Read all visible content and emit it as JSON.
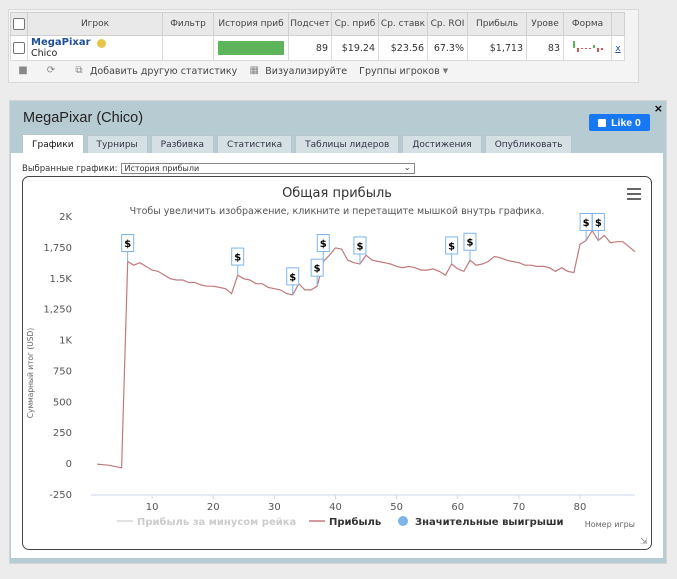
{
  "stats_table": {
    "headers": [
      "Игрок",
      "Фильтр",
      "История приб",
      "Подсчет",
      "Ср. приб",
      "Ср. ставк",
      "Ср. ROI",
      "Прибыль",
      "Урове",
      "Форма"
    ],
    "row": {
      "player": "MegaPixar",
      "site": "Chico",
      "filter": "",
      "count": "89",
      "avg_profit": "$19.24",
      "avg_stake": "$23.56",
      "avg_roi": "67.3%",
      "profit": "$1,713",
      "level": "83",
      "remove": "x"
    }
  },
  "stats_toolbar": {
    "add_stat": "Добавить другую статистику",
    "visualize": "Визуализируйте",
    "player_groups": "Группы игроков"
  },
  "panel": {
    "title": "MegaPixar (Chico)",
    "like_label": "Like 0",
    "close": "×",
    "tabs": [
      "Графики",
      "Турниры",
      "Разбивка",
      "Статистика",
      "Таблицы лидеров",
      "Достижения",
      "Опубликовать"
    ],
    "active_tab": 0,
    "selector_label": "Выбранные графики:",
    "selector_value": "История прибыли"
  },
  "colors": {
    "profit_line": "#c0797d",
    "rake_line": "#d9d9d9",
    "wins_marker": "#7cb5ec",
    "brand": "#1877f2"
  },
  "icons": {
    "trash": "trash-icon",
    "refresh": "refresh-icon",
    "copy": "copy-icon",
    "chart": "chart-icon",
    "menu": "hamburger-menu-icon",
    "flag": "dollar-flag-icon"
  },
  "chart_data": {
    "type": "line",
    "title": "Общая прибыль",
    "subtitle": "Чтобы увеличить изображение, кликните и перетащите мышкой внутрь графика.",
    "xlabel": "Номер игры",
    "ylabel": "Суммарный итог (USD)",
    "xlim": [
      0,
      89
    ],
    "ylim": [
      -250,
      2000
    ],
    "x_ticks": [
      10,
      20,
      30,
      40,
      50,
      60,
      70,
      80
    ],
    "y_ticks": [
      -250,
      0,
      250,
      500,
      750,
      1000,
      1250,
      1500,
      1750,
      2000
    ],
    "y_tick_labels": [
      "-250",
      "0",
      "250",
      "500",
      "750",
      "1K",
      "1,250",
      "1.5K",
      "1,750",
      "2K"
    ],
    "grid": false,
    "legend": [
      {
        "name": "Прибыль за минусом рейка",
        "enabled": false
      },
      {
        "name": "Прибыль",
        "enabled": true
      },
      {
        "name": "Значительные выигрыши",
        "enabled": true
      }
    ],
    "legend_position": "bottom",
    "series": [
      {
        "name": "Прибыль",
        "x": [
          1,
          2,
          3,
          4,
          5,
          6,
          7,
          8,
          9,
          10,
          11,
          12,
          13,
          14,
          15,
          16,
          17,
          18,
          19,
          20,
          21,
          22,
          23,
          24,
          25,
          26,
          27,
          28,
          29,
          30,
          31,
          32,
          33,
          34,
          35,
          36,
          37,
          38,
          39,
          40,
          41,
          42,
          43,
          44,
          45,
          46,
          47,
          48,
          49,
          50,
          51,
          52,
          53,
          54,
          55,
          56,
          57,
          58,
          59,
          60,
          61,
          62,
          63,
          64,
          65,
          66,
          67,
          68,
          69,
          70,
          71,
          72,
          73,
          74,
          75,
          76,
          77,
          78,
          79,
          80,
          81,
          82,
          83,
          84,
          85,
          86,
          87,
          88,
          89
        ],
        "values": [
          0,
          -5,
          -10,
          -20,
          -30,
          1640,
          1610,
          1630,
          1600,
          1570,
          1560,
          1530,
          1500,
          1490,
          1490,
          1470,
          1470,
          1450,
          1440,
          1440,
          1430,
          1420,
          1380,
          1530,
          1500,
          1490,
          1460,
          1460,
          1430,
          1420,
          1410,
          1380,
          1370,
          1460,
          1410,
          1410,
          1440,
          1640,
          1690,
          1750,
          1740,
          1650,
          1630,
          1620,
          1690,
          1650,
          1640,
          1630,
          1620,
          1600,
          1590,
          1600,
          1590,
          1570,
          1570,
          1580,
          1560,
          1530,
          1620,
          1580,
          1560,
          1650,
          1610,
          1620,
          1640,
          1680,
          1670,
          1650,
          1640,
          1630,
          1610,
          1610,
          1600,
          1600,
          1590,
          1560,
          1590,
          1560,
          1550,
          1780,
          1810,
          1890,
          1810,
          1850,
          1790,
          1800,
          1800,
          1760,
          1720
        ]
      }
    ],
    "big_wins_x": [
      6,
      24,
      33,
      37,
      38,
      44,
      59,
      62,
      81,
      83
    ]
  }
}
